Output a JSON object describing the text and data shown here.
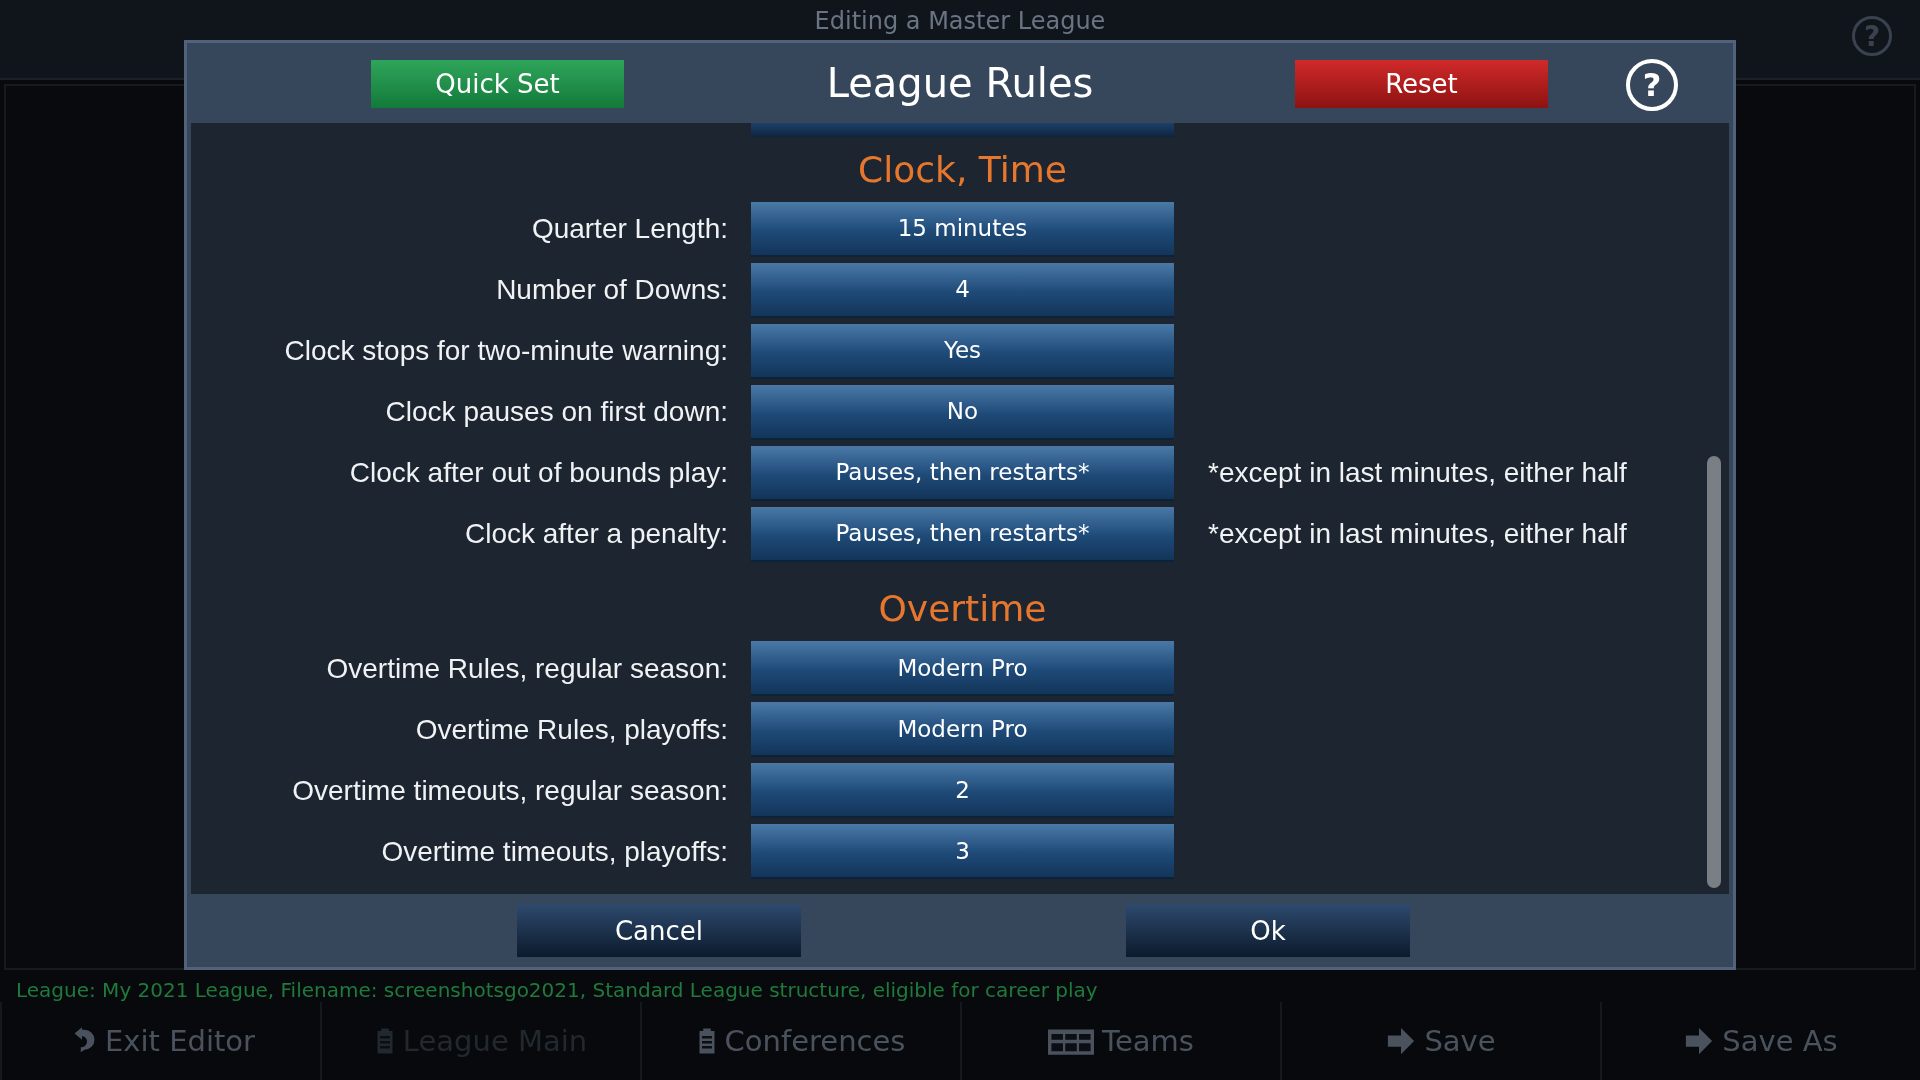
{
  "background": {
    "title": "Editing a Master League",
    "help": "?",
    "status": "League: My 2021 League, Filename: screenshotsgo2021, Standard League structure, eligible for career play",
    "toolbar": [
      {
        "label": "Exit Editor",
        "kind": "undo",
        "disabled": false
      },
      {
        "label": "League Main",
        "kind": "clipboard",
        "disabled": true
      },
      {
        "label": "Conferences",
        "kind": "clipboard",
        "disabled": false
      },
      {
        "label": "Teams",
        "kind": "grid",
        "disabled": false
      },
      {
        "label": "Save",
        "kind": "arrow",
        "disabled": false
      },
      {
        "label": "Save As",
        "kind": "arrow",
        "disabled": false
      }
    ]
  },
  "dialog": {
    "title": "League Rules",
    "quick_set": "Quick Set",
    "reset": "Reset",
    "help": "?",
    "sections": [
      {
        "heading": "Clock, Time",
        "rows": [
          {
            "label": "Quarter Length:",
            "value": "15 minutes"
          },
          {
            "label": "Number of Downs:",
            "value": "4"
          },
          {
            "label": "Clock stops for two-minute warning:",
            "value": "Yes"
          },
          {
            "label": "Clock pauses on first down:",
            "value": "No"
          },
          {
            "label": "Clock after out of bounds play:",
            "value": "Pauses, then restarts*",
            "note": "*except in last minutes, either half"
          },
          {
            "label": "Clock after a penalty:",
            "value": "Pauses, then restarts*",
            "note": "*except in last minutes, either half"
          }
        ]
      },
      {
        "heading": "Overtime",
        "rows": [
          {
            "label": "Overtime Rules, regular season:",
            "value": "Modern Pro"
          },
          {
            "label": "Overtime Rules, playoffs:",
            "value": "Modern Pro"
          },
          {
            "label": "Overtime timeouts, regular season:",
            "value": "2"
          },
          {
            "label": "Overtime timeouts, playoffs:",
            "value": "3"
          }
        ]
      }
    ],
    "buttons": [
      "Cancel",
      "Ok"
    ]
  }
}
